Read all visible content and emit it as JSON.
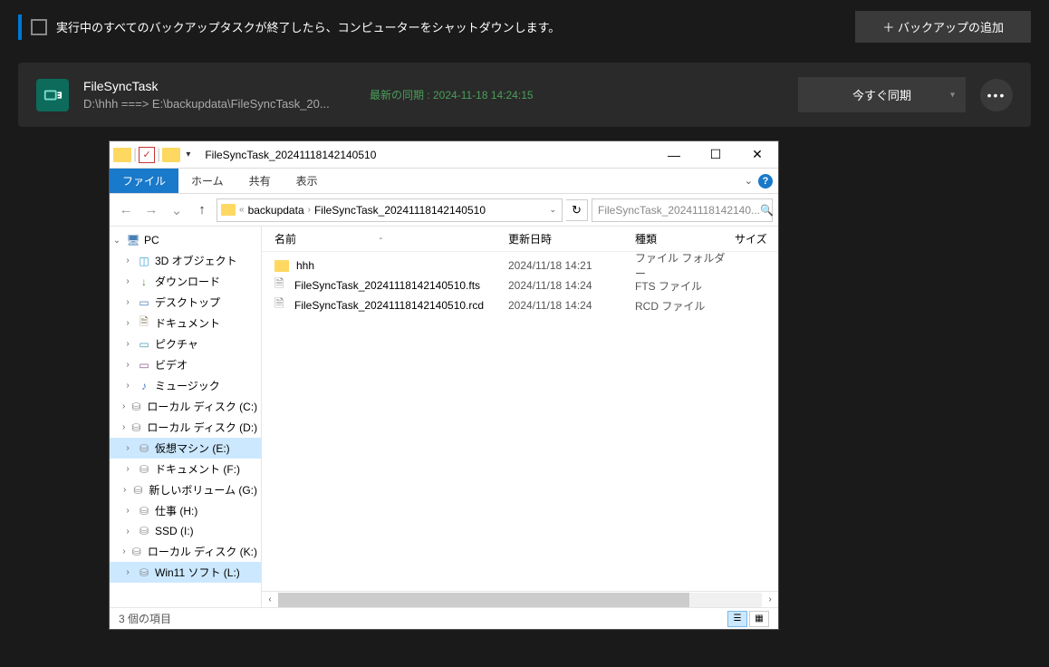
{
  "topbar": {
    "shutdown_text": "実行中のすべてのバックアップタスクが終了したら、コンピューターをシャットダウンします。",
    "add_backup": "＋ バックアップの追加"
  },
  "task": {
    "title": "FileSyncTask",
    "path": "D:\\hhh ===> E:\\backupdata\\FileSyncTask_20...",
    "sync_status": "最新の同期 : 2024-11-18 14:24:15",
    "sync_btn": "今すぐ同期",
    "dropdown": "▾",
    "more": "•••"
  },
  "explorer": {
    "window_title": "FileSyncTask_20241118142140510",
    "ribbon": {
      "file": "ファイル",
      "home": "ホーム",
      "share": "共有",
      "view": "表示"
    },
    "breadcrumb": {
      "part1": "backupdata",
      "part2": "FileSyncTask_20241118142140510"
    },
    "search_placeholder": "FileSyncTask_20241118142140...",
    "tree": {
      "pc": "PC",
      "items": [
        {
          "label": "3D オブジェクト",
          "icon_class": "icon-3d",
          "glyph": "◫"
        },
        {
          "label": "ダウンロード",
          "icon_class": "icon-download",
          "glyph": "↓"
        },
        {
          "label": "デスクトップ",
          "icon_class": "icon-desktop",
          "glyph": "▭"
        },
        {
          "label": "ドキュメント",
          "icon_class": "icon-doc",
          "glyph": "🗎"
        },
        {
          "label": "ピクチャ",
          "icon_class": "icon-pic",
          "glyph": "▭"
        },
        {
          "label": "ビデオ",
          "icon_class": "icon-video",
          "glyph": "▭"
        },
        {
          "label": "ミュージック",
          "icon_class": "icon-music",
          "glyph": "♪"
        },
        {
          "label": "ローカル ディスク (C:)",
          "icon_class": "icon-disk",
          "glyph": "⛁"
        },
        {
          "label": "ローカル ディスク (D:)",
          "icon_class": "icon-disk",
          "glyph": "⛁"
        },
        {
          "label": "仮想マシン (E:)",
          "icon_class": "icon-disk",
          "glyph": "⛁",
          "selected": true
        },
        {
          "label": "ドキュメント (F:)",
          "icon_class": "icon-disk",
          "glyph": "⛁"
        },
        {
          "label": "新しいボリューム (G:)",
          "icon_class": "icon-disk",
          "glyph": "⛁"
        },
        {
          "label": "仕事 (H:)",
          "icon_class": "icon-disk",
          "glyph": "⛁"
        },
        {
          "label": "SSD (I:)",
          "icon_class": "icon-disk",
          "glyph": "⛁"
        },
        {
          "label": "ローカル ディスク (K:)",
          "icon_class": "icon-disk",
          "glyph": "⛁"
        },
        {
          "label": "Win11 ソフト (L:)",
          "icon_class": "icon-disk",
          "glyph": "⛁",
          "selected": true
        }
      ]
    },
    "columns": {
      "name": "名前",
      "date": "更新日時",
      "type": "種類",
      "size": "サイズ"
    },
    "files": [
      {
        "name": "hhh",
        "date": "2024/11/18 14:21",
        "type": "ファイル フォルダー",
        "is_folder": true
      },
      {
        "name": "FileSyncTask_20241118142140510.fts",
        "date": "2024/11/18 14:24",
        "type": "FTS ファイル",
        "is_folder": false
      },
      {
        "name": "FileSyncTask_20241118142140510.rcd",
        "date": "2024/11/18 14:24",
        "type": "RCD ファイル",
        "is_folder": false
      }
    ],
    "status": "3 個の項目"
  }
}
